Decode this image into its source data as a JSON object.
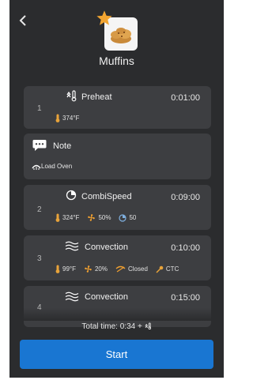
{
  "header": {
    "back_icon": "chevron-left-icon",
    "favorite_icon": "star-icon",
    "title": "Muffins"
  },
  "steps": [
    {
      "number": "1",
      "name": "Preheat",
      "icon": "preheat-icon",
      "time": "0:01:00",
      "params": [
        {
          "icon": "thermometer-icon",
          "text": "374°F"
        }
      ]
    },
    {
      "number": "2",
      "name": "CombiSpeed",
      "icon": "combispeed-icon",
      "time": "0:09:00",
      "params": [
        {
          "icon": "thermometer-icon",
          "text": "324°F"
        },
        {
          "icon": "fan-icon",
          "text": "50%"
        },
        {
          "icon": "microwave-icon",
          "text": "50"
        }
      ]
    },
    {
      "number": "3",
      "name": "Convection",
      "icon": "convection-icon",
      "time": "0:10:00",
      "params": [
        {
          "icon": "thermometer-icon",
          "text": "99°F"
        },
        {
          "icon": "fan-icon",
          "text": "20%"
        },
        {
          "icon": "damper-icon",
          "text": "Closed"
        },
        {
          "icon": "core-temp-icon",
          "text": "CTC"
        }
      ]
    },
    {
      "number": "4",
      "name": "Convection",
      "icon": "convection-icon",
      "time": "0:15:00"
    }
  ],
  "note": {
    "title": "Note",
    "icon": "chat-icon",
    "text": "Load Oven",
    "text_icon": "load-oven-icon"
  },
  "footer": {
    "total_time": "Total time: 0:34 +",
    "total_icon": "preheat-icon",
    "start_label": "Start"
  },
  "colors": {
    "background": "#2b2c2e",
    "card": "#3d3e41",
    "accent": "#1976d2",
    "temp": "#e8a33a",
    "fan": "#f0a030",
    "star": "#f2a531"
  }
}
